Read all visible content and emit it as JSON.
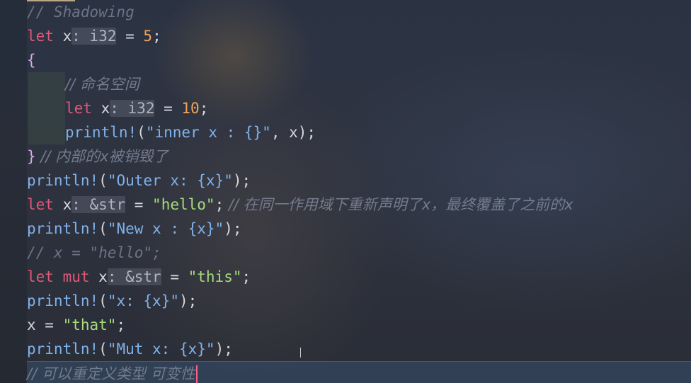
{
  "editor": {
    "lines": [
      {
        "comment": "// Shadowing"
      },
      {
        "kw": "let",
        "var": "x",
        "hint": ": i32",
        "eq": " = ",
        "num": "5",
        "end": ";"
      },
      {
        "brace": "{"
      },
      {
        "comment": "// 命名空间"
      },
      {
        "kw": "let",
        "var": "x",
        "hint": ": i32",
        "eq": " = ",
        "num": "10",
        "end": ";"
      },
      {
        "macro": "println!",
        "open": "(",
        "str": "\"inner x : {}\"",
        "args": ", x",
        "close": ");"
      },
      {
        "brace": "}",
        "comment": " // 内部的x被销毁了"
      },
      {
        "macro": "println!",
        "open": "(",
        "str1": "\"Outer x: ",
        "fmt": "{x}",
        "str2": "\"",
        "close": ");"
      },
      {
        "kw": "let",
        "var": "x",
        "hint": ": &str",
        "eq": " = ",
        "str": "\"hello\"",
        "end": ";",
        "comment": " // 在同一作用域下重新声明了x，最终覆盖了之前的x"
      },
      {
        "macro": "println!",
        "open": "(",
        "str1": "\"New x : ",
        "fmt": "{x}",
        "str2": "\"",
        "close": ");"
      },
      {
        "comment": "// x = \"hello\";"
      },
      {
        "kw": "let mut",
        "var": "x",
        "hint": ": &str",
        "eq": " = ",
        "str": "\"this\"",
        "end": ";"
      },
      {
        "macro": "println!",
        "open": "(",
        "str1": "\"x: ",
        "fmt": "{x}",
        "str2": "\"",
        "close": ");"
      },
      {
        "var": "x",
        "eq": " = ",
        "str": "\"that\"",
        "end": ";"
      },
      {
        "macro": "println!",
        "open": "(",
        "str1": "\"Mut x: ",
        "fmt": "{x}",
        "str2": "\"",
        "close": ");"
      },
      {
        "comment": "// 可以重定义类型 可变性"
      }
    ]
  },
  "colors": {
    "keyword": "#e0587a",
    "macro": "#7fb2ea",
    "string": "#a6dc7c",
    "number": "#f0a35c",
    "comment": "#6b7385",
    "cursor": "#ff5e8a"
  }
}
